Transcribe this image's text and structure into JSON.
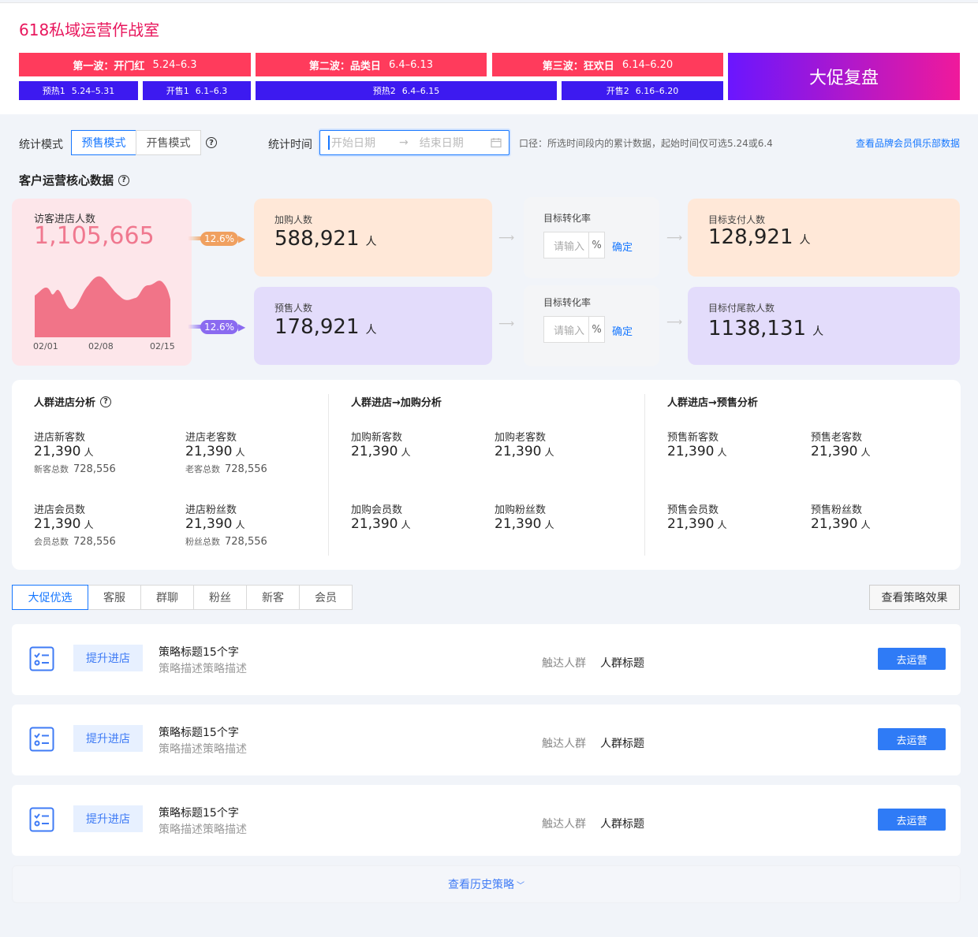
{
  "header": {
    "title": "618私域运营作战室",
    "waves": [
      {
        "name": "第一波：开门红",
        "dates": "5.24–6.3"
      },
      {
        "name": "第二波：品类日",
        "dates": "6.4–6.13"
      },
      {
        "name": "第三波：狂欢日",
        "dates": "6.14–6.20"
      }
    ],
    "subs": [
      {
        "name": "预热1",
        "dates": "5.24–5.31"
      },
      {
        "name": "开售1",
        "dates": "6.1–6.3"
      },
      {
        "name": "预热2",
        "dates": "6.4–6.15"
      },
      {
        "name": "开售2",
        "dates": "6.16–6.20"
      }
    ],
    "review_label": "大促复盘",
    "colors": {
      "title": "#e8175d",
      "wave": "#ff3b5c",
      "sub": "#3d1af0",
      "review_gradient_start": "#6a16ff",
      "review_gradient_end": "#f0199b"
    }
  },
  "filter": {
    "mode_label": "统计模式",
    "modes": [
      "预售模式",
      "开售模式"
    ],
    "active_mode": "预售模式",
    "time_label": "统计时间",
    "start_placeholder": "开始日期",
    "end_placeholder": "结束日期",
    "caliber": "口径：所选时间段内的累计数据，起始时间仅可选5.24或6.4",
    "brand_link": "查看品牌会员俱乐部数据"
  },
  "core": {
    "title": "客户运营核心数据",
    "visit": {
      "label": "访客进店人数",
      "value": "1,105,665",
      "x_ticks": [
        "02/01",
        "02/08",
        "02/15"
      ]
    },
    "pill_top": "12.6%",
    "pill_bottom": "12.6%",
    "add_cart": {
      "label": "加购人数",
      "value": "588,921",
      "unit": "人"
    },
    "presale": {
      "label": "预售人数",
      "value": "178,921",
      "unit": "人"
    },
    "conv_top": {
      "label": "目标转化率",
      "placeholder": "请输入",
      "pct": "%",
      "confirm": "确定"
    },
    "conv_bottom": {
      "label": "目标转化率",
      "placeholder": "请输入",
      "pct": "%",
      "confirm": "确定"
    },
    "target_pay": {
      "label": "目标支付人数",
      "value": "128,921",
      "unit": "人"
    },
    "target_final": {
      "label": "目标付尾款人数",
      "value": "1138,131",
      "unit": "人"
    }
  },
  "analysis": {
    "sections": [
      {
        "title": "人群进店分析",
        "metrics": [
          {
            "label": "进店新客数",
            "value": "21,390",
            "unit": "人",
            "total_label": "新客总数",
            "total": "728,556"
          },
          {
            "label": "进店老客数",
            "value": "21,390",
            "unit": "人",
            "total_label": "老客总数",
            "total": "728,556"
          },
          {
            "label": "进店会员数",
            "value": "21,390",
            "unit": "人",
            "total_label": "会员总数",
            "total": "728,556"
          },
          {
            "label": "进店粉丝数",
            "value": "21,390",
            "unit": "人",
            "total_label": "粉丝总数",
            "total": "728,556"
          }
        ]
      },
      {
        "title": "人群进店→加购分析",
        "metrics": [
          {
            "label": "加购新客数",
            "value": "21,390",
            "unit": "人"
          },
          {
            "label": "加购老客数",
            "value": "21,390",
            "unit": "人"
          },
          {
            "label": "加购会员数",
            "value": "21,390",
            "unit": "人"
          },
          {
            "label": "加购粉丝数",
            "value": "21,390",
            "unit": "人"
          }
        ]
      },
      {
        "title": "人群进店→预售分析",
        "metrics": [
          {
            "label": "预售新客数",
            "value": "21,390",
            "unit": "人"
          },
          {
            "label": "预售老客数",
            "value": "21,390",
            "unit": "人"
          },
          {
            "label": "预售会员数",
            "value": "21,390",
            "unit": "人"
          },
          {
            "label": "预售粉丝数",
            "value": "21,390",
            "unit": "人"
          }
        ]
      }
    ]
  },
  "tabs": [
    "大促优选",
    "客服",
    "群聊",
    "粉丝",
    "新客",
    "会员"
  ],
  "active_tab": "大促优选",
  "effect_button": "查看策略效果",
  "strategies": [
    {
      "tag": "提升进店",
      "title": "策略标题15个字",
      "desc": "策略描述策略描述",
      "reach_label": "触达人群",
      "group": "人群标题",
      "action": "去运营"
    },
    {
      "tag": "提升进店",
      "title": "策略标题15个字",
      "desc": "策略描述策略描述",
      "reach_label": "触达人群",
      "group": "人群标题",
      "action": "去运营"
    },
    {
      "tag": "提升进店",
      "title": "策略标题15个字",
      "desc": "策略描述策略描述",
      "reach_label": "触达人群",
      "group": "人群标题",
      "action": "去运营"
    }
  ],
  "history_link": "查看历史策略",
  "icons": {
    "help": "question-circle-icon",
    "calendar": "calendar-icon",
    "checklist": "checklist-icon",
    "chevron": "chevron-down-icon",
    "arrow": "arrow-right-icon"
  }
}
